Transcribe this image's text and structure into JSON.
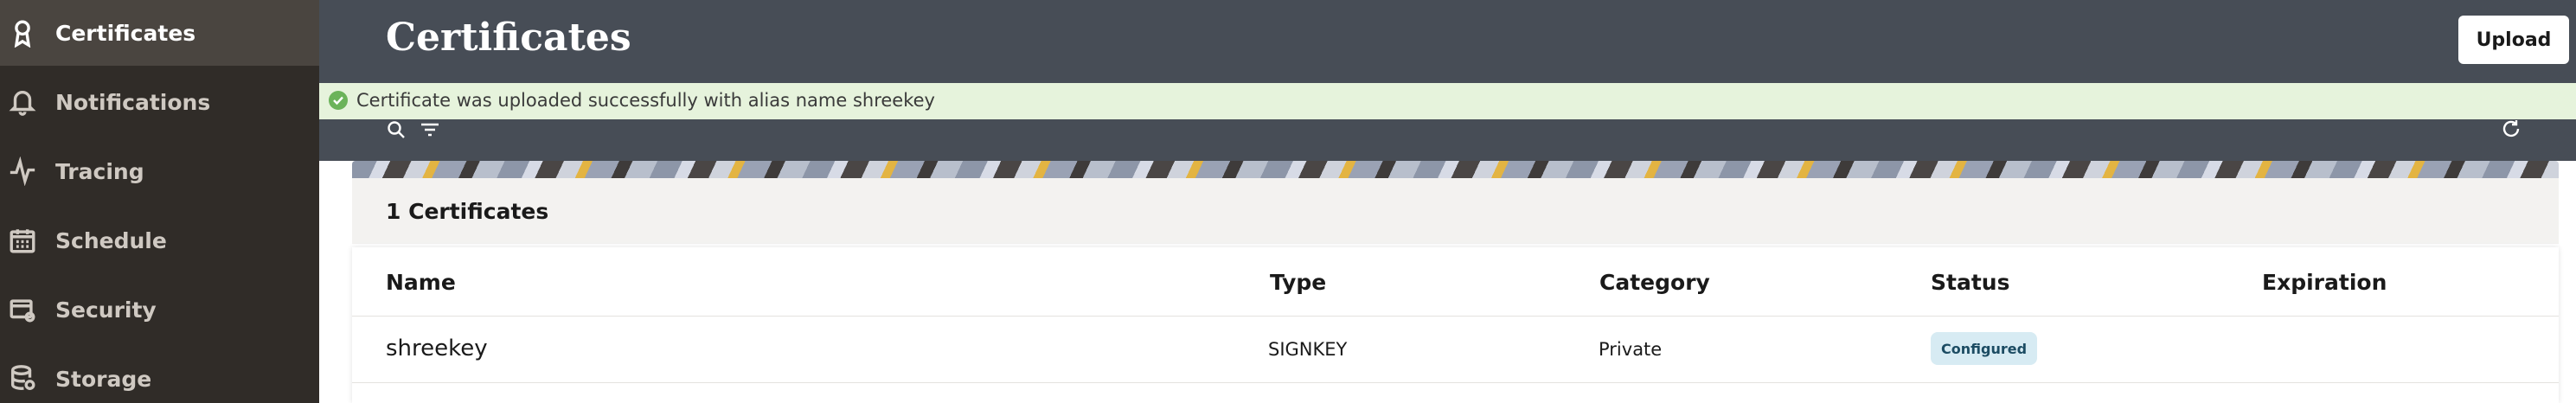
{
  "sidebar": {
    "items": [
      {
        "label": "Certificates",
        "icon": "certificate-icon",
        "active": true
      },
      {
        "label": "Notifications",
        "icon": "bell-icon",
        "active": false
      },
      {
        "label": "Tracing",
        "icon": "pulse-icon",
        "active": false
      },
      {
        "label": "Schedule",
        "icon": "calendar-icon",
        "active": false
      },
      {
        "label": "Security",
        "icon": "security-settings-icon",
        "active": false
      },
      {
        "label": "Storage",
        "icon": "database-icon",
        "active": false
      }
    ]
  },
  "header": {
    "title": "Certificates",
    "upload_label": "Upload"
  },
  "banner": {
    "message": "Certificate was uploaded successfully with alias name shreekey",
    "status_color": "#6bb35a"
  },
  "list": {
    "count_label": "1 Certificates",
    "columns": [
      "Name",
      "Type",
      "Category",
      "Status",
      "Expiration"
    ],
    "rows": [
      {
        "name": "shreekey",
        "type": "SIGNKEY",
        "category": "Private",
        "status": "Configured",
        "expiration": ""
      }
    ]
  },
  "colors": {
    "sidebar_bg": "#302c28",
    "header_bg": "#474d56",
    "banner_bg": "#e6f3dc"
  }
}
